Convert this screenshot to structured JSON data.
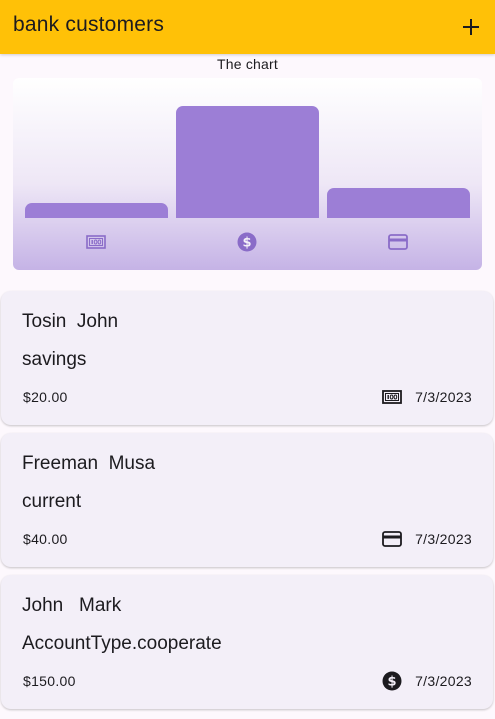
{
  "app_bar": {
    "title": "bank customers",
    "add_icon": "add-icon",
    "background_color": "#ffc107"
  },
  "chart": {
    "title": "The chart",
    "bar_color": "#9c7ed6",
    "chart_data": {
      "type": "bar",
      "categories": [
        "money-icon",
        "dollar-circle-icon",
        "credit-card-icon"
      ],
      "values": [
        20,
        150,
        40
      ],
      "ylim": [
        0,
        160
      ],
      "grid": false
    }
  },
  "customers": [
    {
      "name": "Tosin  John",
      "account_type": "savings",
      "amount": "$20.00",
      "icon": "money-icon",
      "date": "7/3/2023"
    },
    {
      "name": "Freeman  Musa",
      "account_type": "current",
      "amount": "$40.00",
      "icon": "credit-card-icon",
      "date": "7/3/2023"
    },
    {
      "name": "John   Mark",
      "account_type": "AccountType.cooperate",
      "amount": "$150.00",
      "icon": "dollar-circle-icon",
      "date": "7/3/2023"
    }
  ]
}
